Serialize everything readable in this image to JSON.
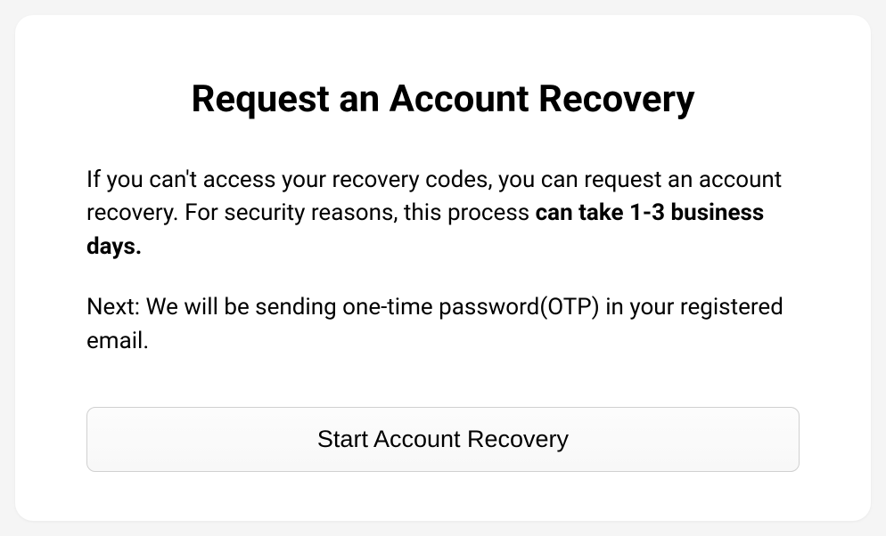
{
  "title": "Request an Account Recovery",
  "description": {
    "part1": "If you can't access your recovery codes, you can request an account recovery. For security reasons, this process ",
    "bold": "can take 1-3 business days."
  },
  "next_info": "Next: We will be sending one-time password(OTP) in your registered email.",
  "button_label": "Start Account Recovery"
}
